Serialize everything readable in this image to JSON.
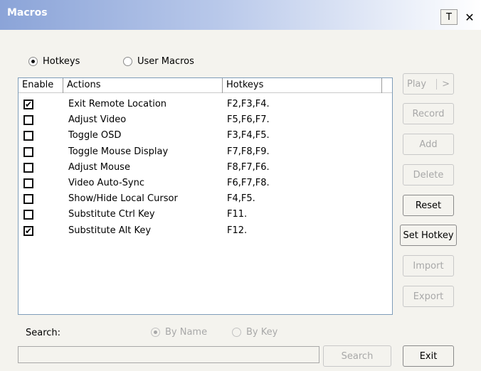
{
  "window": {
    "title": "Macros",
    "pin_glyph": "T",
    "close_glyph": "✕"
  },
  "mode": {
    "hotkeys_label": "Hotkeys",
    "user_macros_label": "User Macros",
    "selected": "Hotkeys"
  },
  "table": {
    "columns": [
      "Enable",
      "Actions",
      "Hotkeys"
    ],
    "rows": [
      {
        "enabled": true,
        "action": "Exit Remote Location",
        "hotkeys": "F2,F3,F4."
      },
      {
        "enabled": false,
        "action": "Adjust Video",
        "hotkeys": "F5,F6,F7."
      },
      {
        "enabled": false,
        "action": "Toggle OSD",
        "hotkeys": "F3,F4,F5."
      },
      {
        "enabled": false,
        "action": "Toggle Mouse Display",
        "hotkeys": "F7,F8,F9."
      },
      {
        "enabled": false,
        "action": "Adjust Mouse",
        "hotkeys": "F8,F7,F6."
      },
      {
        "enabled": false,
        "action": "Video Auto-Sync",
        "hotkeys": "F6,F7,F8."
      },
      {
        "enabled": false,
        "action": "Show/Hide Local Cursor",
        "hotkeys": "F4,F5."
      },
      {
        "enabled": false,
        "action": "Substitute Ctrl Key",
        "hotkeys": "F11."
      },
      {
        "enabled": true,
        "action": "Substitute Alt Key",
        "hotkeys": "F12."
      }
    ]
  },
  "buttons": {
    "play": "Play",
    "play_arrow": ">",
    "record": "Record",
    "add": "Add",
    "delete": "Delete",
    "reset": "Reset",
    "set_hotkey": "Set Hotkey",
    "import": "Import",
    "export": "Export",
    "exit": "Exit"
  },
  "search": {
    "label": "Search:",
    "by_name_label": "By Name",
    "by_key_label": "By Key",
    "selected": "By Name",
    "value": "",
    "button_label": "Search"
  },
  "icons": {
    "check": "✔",
    "pin": "pin-icon",
    "close": "close-icon"
  }
}
